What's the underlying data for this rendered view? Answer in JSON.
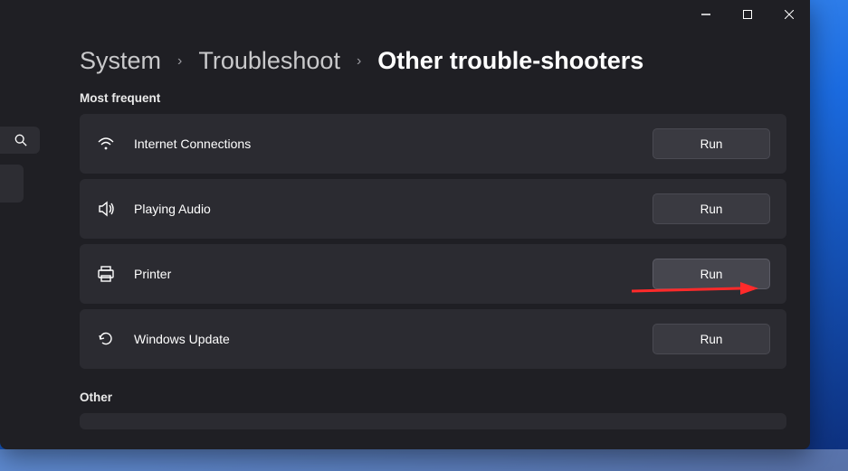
{
  "window_controls": {
    "minimize": "minimize",
    "maximize": "maximize",
    "close": "close"
  },
  "breadcrumb": {
    "part1": "System",
    "part2": "Troubleshoot",
    "current": "Other trouble-shooters"
  },
  "sections": {
    "most_frequent": "Most frequent",
    "other": "Other"
  },
  "items": [
    {
      "label": "Internet Connections",
      "button": "Run",
      "icon": "wifi"
    },
    {
      "label": "Playing Audio",
      "button": "Run",
      "icon": "speaker"
    },
    {
      "label": "Printer",
      "button": "Run",
      "icon": "printer",
      "highlight": true
    },
    {
      "label": "Windows Update",
      "button": "Run",
      "icon": "refresh"
    }
  ],
  "annotation": {
    "arrow_color": "#ff2a2a"
  }
}
